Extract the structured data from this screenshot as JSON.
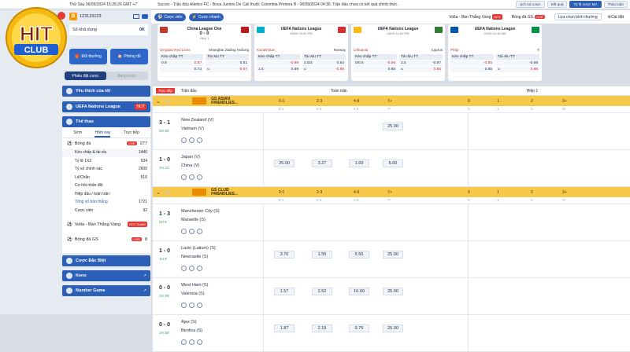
{
  "topbar": {
    "date": "Thứ Sáu 06/09/2024 15:26:26 GMT +7",
    "ticker": "Soccer - Trận đấu Atletico FC - Boca Juniors De Cali thuộc Colombia Primera B - 06/09/2024 04:30. Trận đấu chưa có kết quả chính thức.",
    "buttons": [
      "Lịch sử cược",
      "Kết quả",
      "Tỷ lệ cược MA",
      "Thảo luận"
    ]
  },
  "logo": {
    "text_top": "HIT",
    "text_bottom": "CLUB"
  },
  "account": {
    "username": "123123123",
    "balance_label": "Số khả dụng",
    "balance": "0K"
  },
  "promo": {
    "deposit": "Đổi thưởng",
    "room": "Phòng đỏ"
  },
  "segment": {
    "left": "Phiếu đặt cược",
    "right": "Bảng cược"
  },
  "sidebar": {
    "favorites": "Yêu thích của tôi",
    "nations": "UEFA Nations League",
    "sports": "Thể thao",
    "sport_tabs": [
      "Sớm",
      "Hôm nay",
      "Trực tiếp"
    ],
    "soccer": {
      "label": "Bóng đá",
      "count": "277"
    },
    "soccer_items": [
      {
        "label": "Kèo chấp & tài xỉu",
        "count": "1446"
      },
      {
        "label": "Tỷ lệ 1X2",
        "count": "534"
      },
      {
        "label": "Tỷ số chính xác",
        "count": "2600"
      },
      {
        "label": "Lẻ/Chẵn",
        "count": "510"
      },
      {
        "label": "Cơ hội nhân đôi",
        "count": ""
      },
      {
        "label": "Hiệp đầu / toàn trận",
        "count": ""
      },
      {
        "label": "Tổng số bàn thắng",
        "count": "1721"
      },
      {
        "label": "Cược xiên",
        "count": "92"
      }
    ],
    "volta": "Volta - Bàn Thắng Vàng",
    "volta_badge": "HOT GAME",
    "bongda_gs": {
      "label": "Bóng đá GS",
      "count": "8"
    },
    "special": "Cược Đặc Biệt",
    "keno": "Keno",
    "number_game": "Number Game"
  },
  "main_top": {
    "bet_btn": "Cược viên",
    "quick_btn": "Cược nhanh",
    "tab1": "Volta - Bàn Thắng Vàng",
    "tab2": "Bóng đá GS",
    "sort": "Lựa chọn bình thường",
    "settings": "Cài đặt"
  },
  "cards": [
    {
      "league": "China League One",
      "score": "0 - 0",
      "time": "Hiệp 1",
      "home": "Qingdao Red Lions",
      "away": "Shanghai Jiading Huilong",
      "hcap_label": "Kèo chấp TT",
      "ou_label": "Tài Xỉu TT",
      "rows": [
        [
          "0.9",
          "0.87",
          "",
          "0.81"
        ],
        [
          "",
          "0.73",
          "u",
          "-0.97"
        ]
      ]
    },
    {
      "league": "UEFA Nations League",
      "score": "",
      "time": "06/09 09:00 PM",
      "home": "Kazakhstan",
      "away": "Norway",
      "hcap_label": "Kèo chấp TT",
      "ou_label": "Tài Xỉu TT",
      "rows": [
        [
          "",
          "-0.99",
          "2.5/3",
          "0.84"
        ],
        [
          "1.5",
          "0.89",
          "u",
          "-0.96"
        ]
      ]
    },
    {
      "league": "UEFA Nations League",
      "score": "",
      "time": "06/09 11:00 PM",
      "home": "Lithuania",
      "away": "Cyprus",
      "hcap_label": "Kèo chấp TT",
      "ou_label": "Tài Xỉu TT",
      "rows": [
        [
          "0/0.5",
          "-0.95",
          "2.5",
          "-0.97"
        ],
        [
          "",
          "0.85",
          "u",
          "0.85"
        ]
      ]
    },
    {
      "league": "UEFA Nations League",
      "score": "",
      "time": "07/09 01:45 AM",
      "home": "Pháp",
      "away": "Ý",
      "hcap_label": "Kèo chấp TT",
      "ou_label": "Tài Xỉu TT",
      "rows": [
        [
          "",
          "-0.95",
          "",
          "-0.98"
        ],
        [
          "",
          "0.85",
          "u",
          "0.86"
        ]
      ]
    }
  ],
  "table": {
    "live_tag": "Trực tiếp",
    "col_match": "Trận đấu",
    "full_time": "Toàn trận",
    "half_1": "Hiệp 1",
    "heads": [
      "0-1",
      "2-3",
      "4-6",
      "7+",
      "0",
      "1",
      "2",
      "3+"
    ],
    "leagues": [
      {
        "name": "GS ASIAN FRIENDLIES...",
        "matches": [
          {
            "score": "3 - 1",
            "time": "2H 39'",
            "home": "New Zealand (V)",
            "away": "Vietnam (V)",
            "odds": [
              "",
              "",
              "",
              "25.00"
            ]
          },
          {
            "score": "1 - 0",
            "time": "1H 12'",
            "home": "Japan (V)",
            "away": "China (V)",
            "odds": [
              "25.00",
              "3.27",
              "1.69",
              "6.00"
            ]
          }
        ]
      },
      {
        "name": "GS CLUB FRIENDLIES...",
        "matches": [
          {
            "score": "1 - 3",
            "time": "2H 6'",
            "home": "Manchester City (S)",
            "away": "Marseille (S)",
            "odds": [
              "",
              "",
              "",
              ""
            ]
          },
          {
            "score": "1 - 0",
            "time": "1H 9'",
            "home": "Lazio (Latium) (S)",
            "away": "Newcastle (S)",
            "odds": [
              "3.70",
              "1.55",
              "5.50",
              "25.00"
            ]
          },
          {
            "score": "0 - 0",
            "time": "1H 29'",
            "home": "West Ham (S)",
            "away": "Valencia (S)",
            "odds": [
              "1.57",
              "2.52",
              "16.00",
              "25.00"
            ]
          },
          {
            "score": "0 - 0",
            "time": "1H 38'",
            "home": "Ajax (S)",
            "away": "Benfica (S)",
            "odds": [
              "1.87",
              "2.19",
              "9.75",
              "25.00"
            ]
          }
        ]
      }
    ]
  }
}
